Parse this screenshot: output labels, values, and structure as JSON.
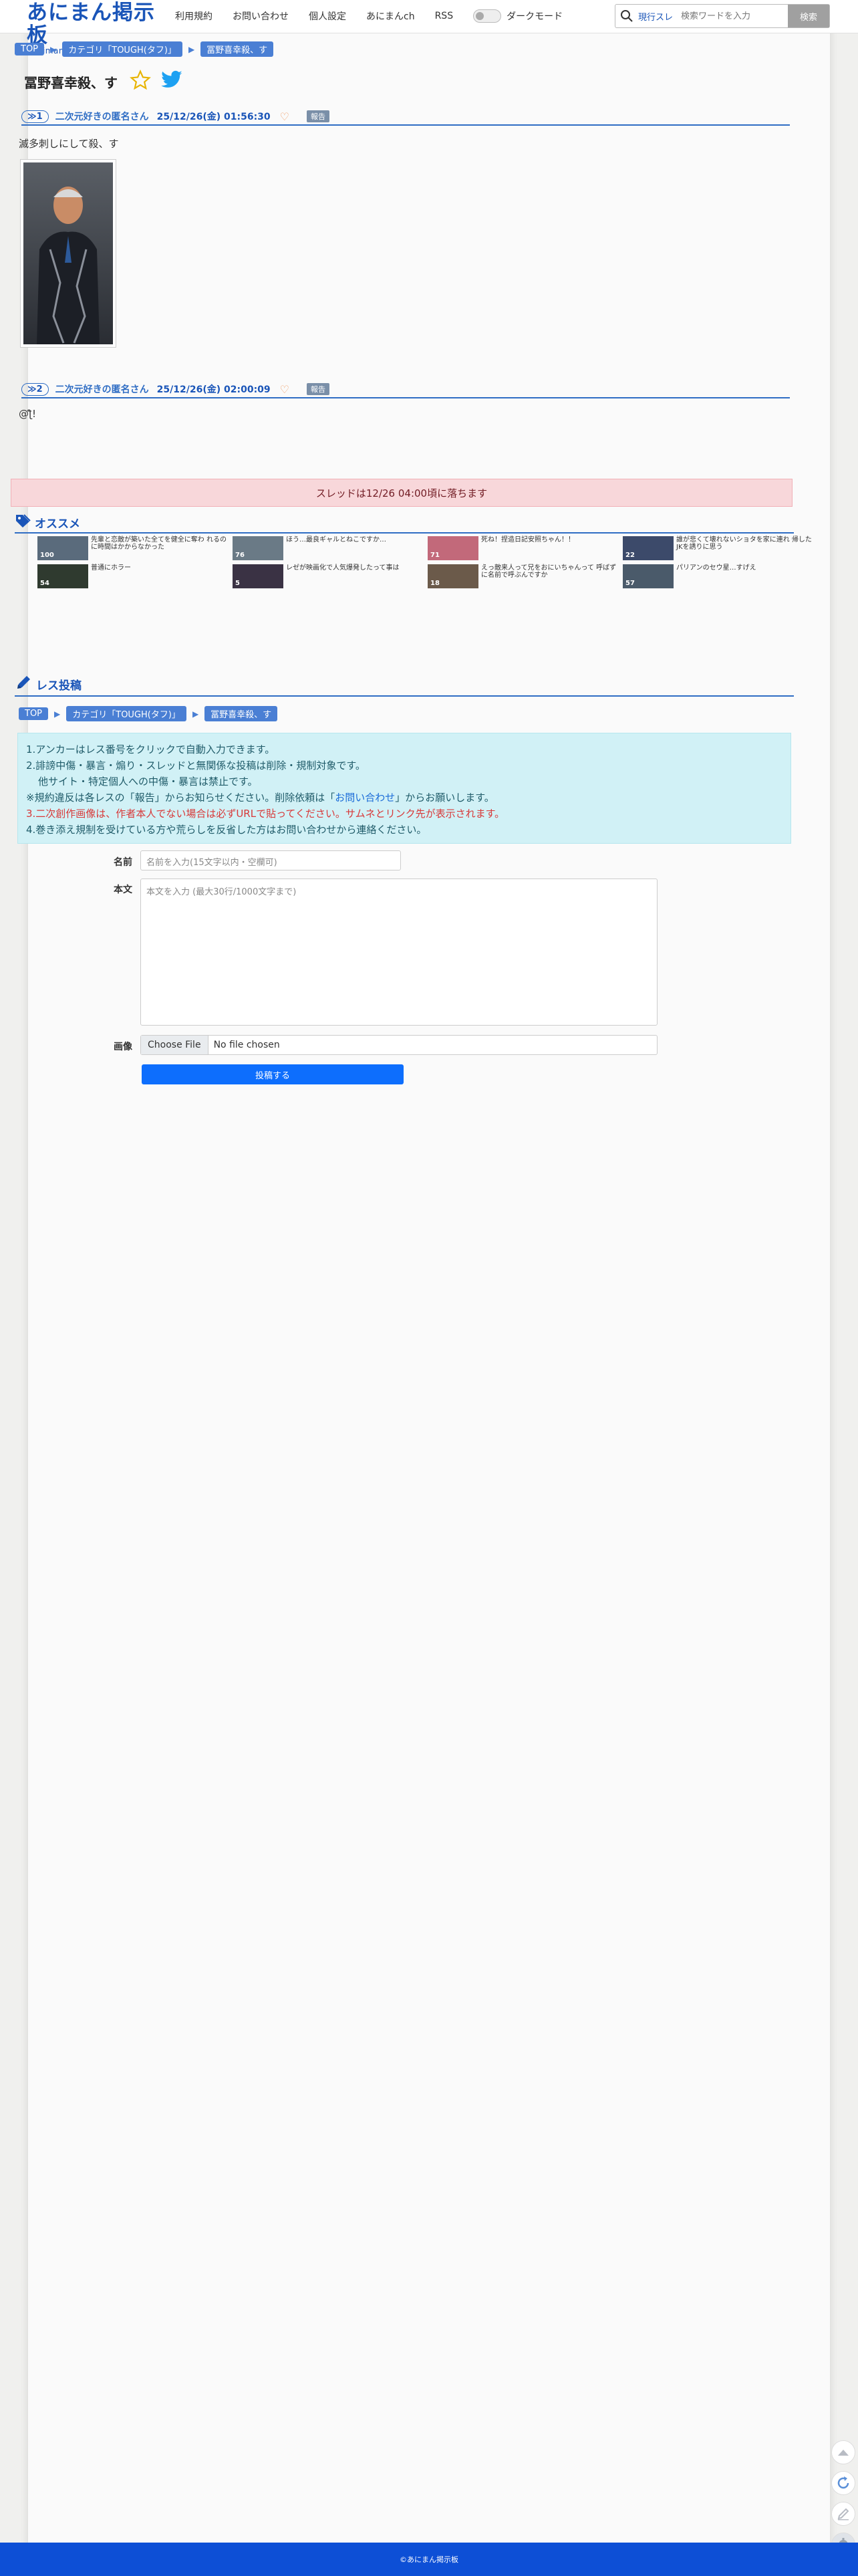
{
  "header": {
    "logo_main": "あにまん掲示板",
    "logo_sub": "animan bbs@二次元オンリー",
    "nav": [
      "利用規約",
      "お問い合わせ",
      "個人設定",
      "あにまんch",
      "RSS"
    ],
    "dark_mode_label": "ダークモード",
    "search_scope": "現行スレ",
    "search_placeholder": "検索ワードを入力",
    "search_button": "検索"
  },
  "breadcrumb": [
    "TOP",
    "カテゴリ「TOUGH(タフ)」",
    "冨野喜幸殺、す"
  ],
  "thread_title": "冨野喜幸殺、す",
  "posts": [
    {
      "no": "≫1",
      "name": "二次元好きの匿名さん",
      "date": "25/12/26(金) 01:56:30",
      "report": "報告",
      "body": "滅多刺しにして殺、す"
    },
    {
      "no": "≫2",
      "name": "二次元好きの匿名さん",
      "date": "25/12/26(金) 02:00:09",
      "report": "報告",
      "body": "@ƪ!"
    }
  ],
  "expire_notice": "スレッドは12/26 04:00頃に落ちます",
  "recommend": {
    "title": "オススメ",
    "items": [
      {
        "text": "先輩と恋敵が築いた全てを健全に奪わ れるのに時間はかからなかった",
        "count": "100",
        "color": "#5a6b7c"
      },
      {
        "text": "ほう…最良ギャルとねこですか…",
        "count": "76",
        "color": "#6a7a86"
      },
      {
        "text": "死ね！捏造日記安照ちゃん！！",
        "count": "71",
        "color": "#c2697a"
      },
      {
        "text": "誰が悲くて壊れないショタを家に連れ 帰したJKを誘りに思う",
        "count": "22",
        "color": "#3c4a6a"
      },
      {
        "text": "普通にホラー",
        "count": "54",
        "color": "#2f3a2f"
      },
      {
        "text": "レゼが映画化で人気爆発したって事は",
        "count": "5",
        "color": "#3a3244"
      },
      {
        "text": "えっ敵来人って兄をおにいちゃんって 呼ばずに名前で呼ぶんですか",
        "count": "18",
        "color": "#6b5a4a"
      },
      {
        "text": "パリアンのセウ星…すげえ",
        "count": "57",
        "color": "#4a5a6a"
      }
    ]
  },
  "reply_form": {
    "title": "レス投稿",
    "info": [
      "1.アンカーはレス番号をクリックで自動入力できます。",
      "2.誹謗中傷・暴言・煽り・スレッドと無関係な投稿は削除・規制対象です。",
      "  他サイト・特定個人への中傷・暴言は禁止です。",
      "※規約違反は各レスの「報告」からお知らせください。削除依頼は「",
      "お問い合わせ",
      "」からお願いします。",
      "3.二次創作画像は、作者本人でない場合は必ずURLで貼ってください。サムネとリンク先が表示されます。",
      "4.巻き添え規制を受けている方や荒らしを反省した方はお問い合わせから連絡ください。"
    ],
    "name_label": "名前",
    "name_placeholder": "名前を入力(15文字以内・空欄可)",
    "body_label": "本文",
    "body_placeholder": "本文を入力 (最大30行/1000文字まで)",
    "image_label": "画像",
    "file_button": "Choose File",
    "file_status": "No file chosen",
    "submit": "投稿する"
  },
  "footer": "©あにまん掲示板",
  "colors": {
    "accent": "#2f6dc4",
    "footer": "#0d4fd6",
    "alert_bg": "#f8d7da",
    "info_bg": "#d1f1f6"
  }
}
